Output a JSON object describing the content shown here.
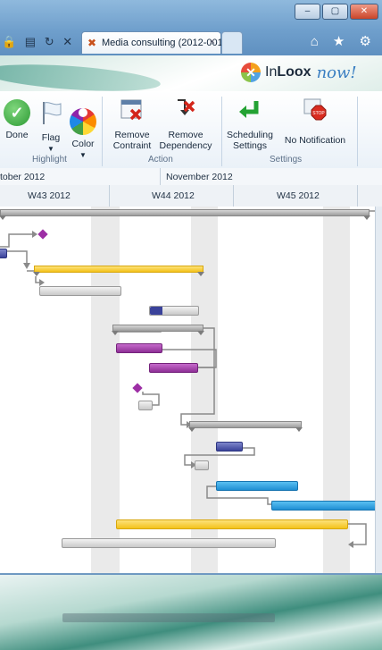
{
  "browser": {
    "tab_title": "Media consulting (2012-0010",
    "tab_close": "×",
    "nav_icons": "🔒 ▤ ↻ ✕",
    "right_icons": "⌂ ★ ⚙",
    "win_buttons": [
      "–",
      "▢",
      "✕"
    ]
  },
  "brand": {
    "in": "In",
    "loox": "Loox",
    "now": "now!"
  },
  "ribbon": {
    "buttons": {
      "done": "Done",
      "flag": "Flag",
      "color": "Color",
      "remove_contraint": [
        "Remove",
        "Contraint"
      ],
      "remove_dependency": [
        "Remove",
        "Dependency"
      ],
      "scheduling_settings": [
        "Scheduling",
        "Settings"
      ],
      "no_notification": "No Notification"
    },
    "groups": {
      "highlight": "Highlight",
      "action": "Action",
      "settings": "Settings"
    }
  },
  "timeline": {
    "months": [
      "tober 2012",
      "November 2012"
    ],
    "weeks": [
      "W43 2012",
      "W44 2012",
      "W45 2012"
    ]
  },
  "colors": {
    "milestone": "#9d2fa5",
    "accent": "#1f8fd3"
  }
}
